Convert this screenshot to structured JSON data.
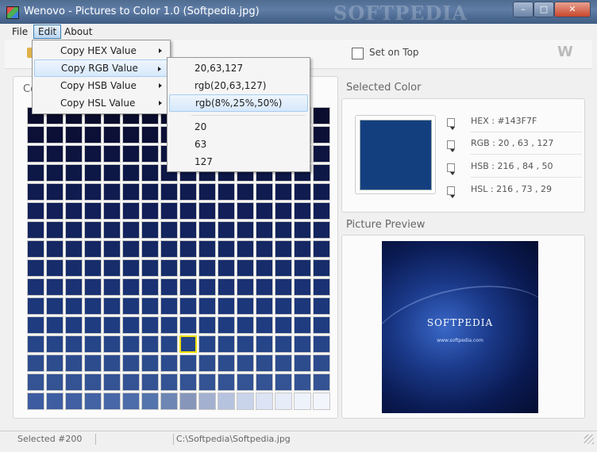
{
  "window": {
    "title": "Wenovo - Pictures to Color 1.0 (Softpedia.jpg)",
    "watermark": "SOFTPEDIA"
  },
  "menubar": {
    "file": "File",
    "edit": "Edit",
    "about": "About"
  },
  "toolbar": {
    "set_on_top": "Set on Top",
    "logo": "W"
  },
  "edit_menu": [
    "Copy HEX Value",
    "Copy RGB Value",
    "Copy HSB Value",
    "Copy HSL Value"
  ],
  "rgb_submenu": {
    "group1": [
      "20,63,127",
      "rgb(20,63,127)",
      "rgb(8%,25%,50%)"
    ],
    "group2": [
      "20",
      "63",
      "127"
    ]
  },
  "selected_color": {
    "title": "Selected Color",
    "swatch_color": "#143F7F",
    "hex": "HEX : #143F7F",
    "rgb": "RGB : 20 , 63 , 127",
    "hsb": "HSB : 216 , 84 , 50",
    "hsl": "HSL : 216 , 73 , 29"
  },
  "preview": {
    "title": "Picture Preview",
    "brand": "SOFTPEDIA",
    "url": "www.softpedia.com"
  },
  "palette": {
    "title": "Co",
    "selected_index": 200,
    "row_colors": [
      "#0b0d2e",
      "#0c1036",
      "#0d143f",
      "#0e1847",
      "#101c50",
      "#121f58",
      "#13245e",
      "#152864",
      "#172d6b",
      "#1a3273",
      "#1c377a",
      "#1f3c80",
      "#264588",
      "#2d4c8e",
      "#345394",
      "#3d5b9b"
    ],
    "last_row": [
      "#3d5ba0",
      "#3f5ea2",
      "#4060a3",
      "#4363a5",
      "#4767a8",
      "#4c6caa",
      "#5474ad",
      "#6d86b3",
      "#8696bb",
      "#a3b0d0",
      "#b6c3df",
      "#c9d4eb",
      "#dbe3f4",
      "#e6ecf8",
      "#eef2fb",
      "#f2f5fc"
    ]
  },
  "status": {
    "selected": "Selected #200",
    "path": "C:\\Softpedia\\Softpedia.jpg"
  }
}
